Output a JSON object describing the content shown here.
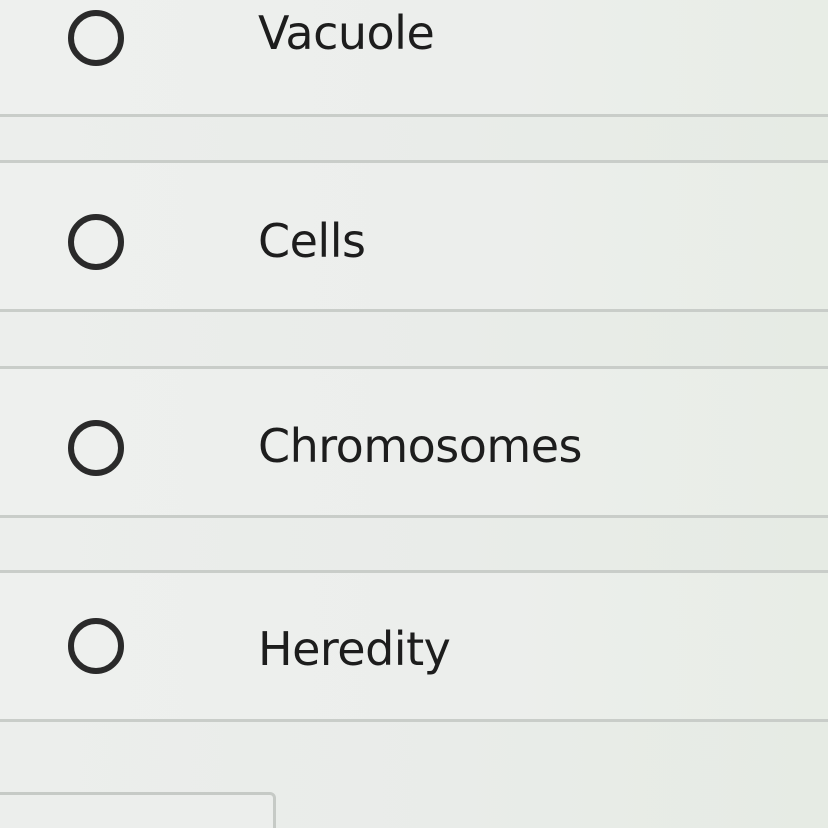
{
  "options": [
    {
      "label": "Vacuole",
      "selected": false
    },
    {
      "label": "Cells",
      "selected": false
    },
    {
      "label": "Chromosomes",
      "selected": false
    },
    {
      "label": "Heredity",
      "selected": false
    }
  ],
  "colors": {
    "background": "#eceeec",
    "row_border": "#c9cdc9",
    "radio_stroke": "#2a2a2a",
    "text": "#1d1d1d"
  }
}
